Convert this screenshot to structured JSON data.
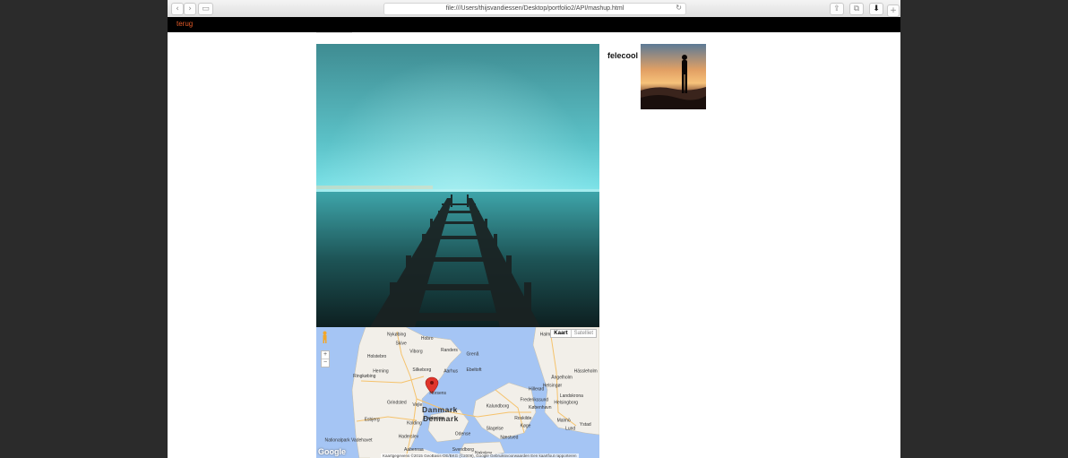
{
  "browser": {
    "url": "file:///Users/thijsvandiessen/Desktop/portfolio2/API/mashup.html"
  },
  "nav": {
    "back_label": "terug"
  },
  "photo": {
    "username": "felecool"
  },
  "map": {
    "map_type_active": "Kaart",
    "map_type_inactive": "Satelliet",
    "country_label_1": "Danmark",
    "country_label_2": "Denmark",
    "google_logo": "Google",
    "attribution": "Kaartgegevens ©2015 GeoBasis-DE/BKG (©2009), Google   Gebruiksvoorwaarden   Een kaartfout rapporteren",
    "zoom_in": "+",
    "zoom_out": "−",
    "places": [
      {
        "name": "Nykøbing",
        "fx": 0.25,
        "fy": 0.03
      },
      {
        "name": "Hobro",
        "fx": 0.37,
        "fy": 0.06
      },
      {
        "name": "Skive",
        "fx": 0.28,
        "fy": 0.1
      },
      {
        "name": "Viborg",
        "fx": 0.33,
        "fy": 0.16
      },
      {
        "name": "Randers",
        "fx": 0.44,
        "fy": 0.15
      },
      {
        "name": "Holstebro",
        "fx": 0.18,
        "fy": 0.2
      },
      {
        "name": "Grenå",
        "fx": 0.53,
        "fy": 0.18
      },
      {
        "name": "Herning",
        "fx": 0.2,
        "fy": 0.31
      },
      {
        "name": "Silkeborg",
        "fx": 0.34,
        "fy": 0.3
      },
      {
        "name": "Aarhus",
        "fx": 0.45,
        "fy": 0.31
      },
      {
        "name": "Ebeltoft",
        "fx": 0.53,
        "fy": 0.3
      },
      {
        "name": "Ringkøbing",
        "fx": 0.13,
        "fy": 0.35
      },
      {
        "name": "Horsens",
        "fx": 0.4,
        "fy": 0.48
      },
      {
        "name": "Grindsted",
        "fx": 0.25,
        "fy": 0.55
      },
      {
        "name": "Vejle",
        "fx": 0.34,
        "fy": 0.57
      },
      {
        "name": "Kalundborg",
        "fx": 0.6,
        "fy": 0.58
      },
      {
        "name": "Frederikssund",
        "fx": 0.72,
        "fy": 0.53
      },
      {
        "name": "Hillerød",
        "fx": 0.75,
        "fy": 0.45
      },
      {
        "name": "Helsingborg",
        "fx": 0.84,
        "fy": 0.55
      },
      {
        "name": "Landskrona",
        "fx": 0.86,
        "fy": 0.5
      },
      {
        "name": "København",
        "fx": 0.75,
        "fy": 0.59
      },
      {
        "name": "Hässleholm",
        "fx": 0.91,
        "fy": 0.31
      },
      {
        "name": "Ängelholm",
        "fx": 0.83,
        "fy": 0.36
      },
      {
        "name": "Esbjerg",
        "fx": 0.17,
        "fy": 0.68
      },
      {
        "name": "Kolding",
        "fx": 0.32,
        "fy": 0.71
      },
      {
        "name": "Fredericia",
        "fx": 0.38,
        "fy": 0.67
      },
      {
        "name": "Roskilde",
        "fx": 0.7,
        "fy": 0.67
      },
      {
        "name": "Malmö",
        "fx": 0.85,
        "fy": 0.69
      },
      {
        "name": "Lund",
        "fx": 0.88,
        "fy": 0.75
      },
      {
        "name": "Ystad",
        "fx": 0.93,
        "fy": 0.72
      },
      {
        "name": "Haderslev",
        "fx": 0.29,
        "fy": 0.81
      },
      {
        "name": "Odense",
        "fx": 0.49,
        "fy": 0.79
      },
      {
        "name": "Slagelse",
        "fx": 0.6,
        "fy": 0.75
      },
      {
        "name": "Næstved",
        "fx": 0.65,
        "fy": 0.82
      },
      {
        "name": "Køge",
        "fx": 0.72,
        "fy": 0.73
      },
      {
        "name": "Nationalpark Vadehavet",
        "fx": 0.03,
        "fy": 0.84
      },
      {
        "name": "Aabenraa",
        "fx": 0.31,
        "fy": 0.91
      },
      {
        "name": "Svendborg",
        "fx": 0.48,
        "fy": 0.91
      },
      {
        "name": "Nakskov",
        "fx": 0.56,
        "fy": 0.94
      },
      {
        "name": "Halmstad",
        "fx": 0.79,
        "fy": 0.03
      },
      {
        "name": "Helsingør",
        "fx": 0.8,
        "fy": 0.42
      }
    ]
  },
  "colors": {
    "nav_bg": "#000000",
    "back_link": "#e35a28",
    "sea": "#a5c5f4",
    "land": "#f2efe9",
    "marker": "#e0352b"
  }
}
